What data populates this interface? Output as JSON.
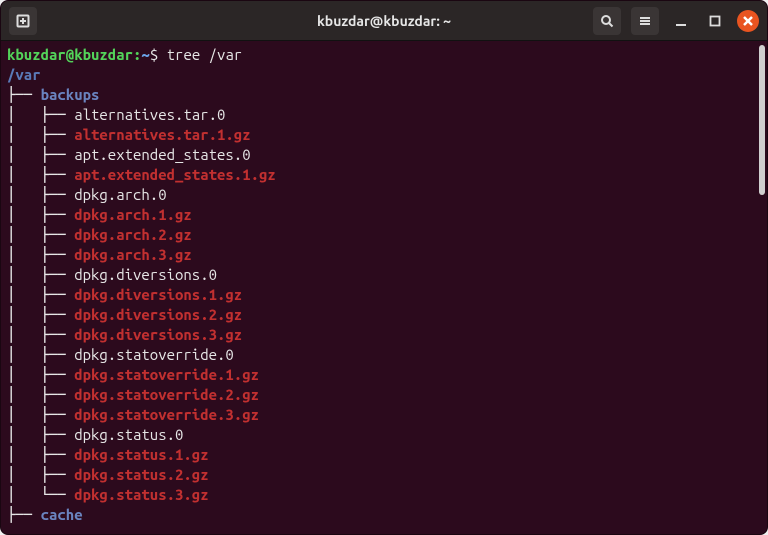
{
  "titlebar": {
    "title": "kbuzdar@kbuzdar: ~"
  },
  "prompt": {
    "user_host": "kbuzdar@kbuzdar",
    "path": "~",
    "symbol": "$",
    "command": "tree /var"
  },
  "tree": {
    "root": "/var",
    "entries": [
      {
        "prefix": "├── ",
        "name": "backups",
        "type": "dir"
      },
      {
        "prefix": "│   ├── ",
        "name": "alternatives.tar.0",
        "type": "plain"
      },
      {
        "prefix": "│   ├── ",
        "name": "alternatives.tar.1.gz",
        "type": "archive"
      },
      {
        "prefix": "│   ├── ",
        "name": "apt.extended_states.0",
        "type": "plain"
      },
      {
        "prefix": "│   ├── ",
        "name": "apt.extended_states.1.gz",
        "type": "archive"
      },
      {
        "prefix": "│   ├── ",
        "name": "dpkg.arch.0",
        "type": "plain"
      },
      {
        "prefix": "│   ├── ",
        "name": "dpkg.arch.1.gz",
        "type": "archive"
      },
      {
        "prefix": "│   ├── ",
        "name": "dpkg.arch.2.gz",
        "type": "archive"
      },
      {
        "prefix": "│   ├── ",
        "name": "dpkg.arch.3.gz",
        "type": "archive"
      },
      {
        "prefix": "│   ├── ",
        "name": "dpkg.diversions.0",
        "type": "plain"
      },
      {
        "prefix": "│   ├── ",
        "name": "dpkg.diversions.1.gz",
        "type": "archive"
      },
      {
        "prefix": "│   ├── ",
        "name": "dpkg.diversions.2.gz",
        "type": "archive"
      },
      {
        "prefix": "│   ├── ",
        "name": "dpkg.diversions.3.gz",
        "type": "archive"
      },
      {
        "prefix": "│   ├── ",
        "name": "dpkg.statoverride.0",
        "type": "plain"
      },
      {
        "prefix": "│   ├── ",
        "name": "dpkg.statoverride.1.gz",
        "type": "archive"
      },
      {
        "prefix": "│   ├── ",
        "name": "dpkg.statoverride.2.gz",
        "type": "archive"
      },
      {
        "prefix": "│   ├── ",
        "name": "dpkg.statoverride.3.gz",
        "type": "archive"
      },
      {
        "prefix": "│   ├── ",
        "name": "dpkg.status.0",
        "type": "plain"
      },
      {
        "prefix": "│   ├── ",
        "name": "dpkg.status.1.gz",
        "type": "archive"
      },
      {
        "prefix": "│   ├── ",
        "name": "dpkg.status.2.gz",
        "type": "archive"
      },
      {
        "prefix": "│   └── ",
        "name": "dpkg.status.3.gz",
        "type": "archive"
      },
      {
        "prefix": "├── ",
        "name": "cache",
        "type": "dir"
      }
    ]
  }
}
